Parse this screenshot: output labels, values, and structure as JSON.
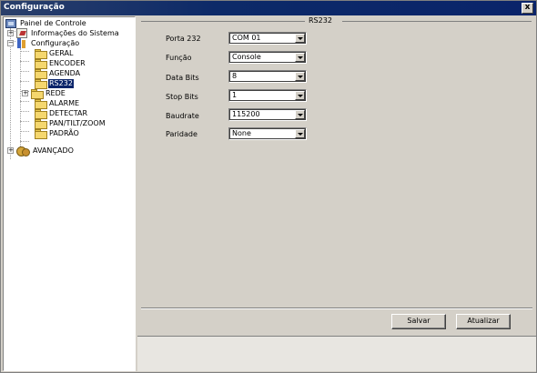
{
  "window": {
    "title": "Configuração",
    "close_label": "x"
  },
  "tree": {
    "root": "Painel de Controle",
    "items": [
      {
        "label": "Informações do Sistema"
      },
      {
        "label": "Configuração"
      },
      {
        "label": "GERAL"
      },
      {
        "label": "ENCODER"
      },
      {
        "label": "AGENDA"
      },
      {
        "label": "RS232"
      },
      {
        "label": "REDE"
      },
      {
        "label": "ALARME"
      },
      {
        "label": "DETECTAR"
      },
      {
        "label": "PAN/TILT/ZOOM"
      },
      {
        "label": "PADRÃO"
      },
      {
        "label": "AVANÇADO"
      }
    ]
  },
  "panel": {
    "group_title": "RS232",
    "fields": [
      {
        "label": "Porta 232",
        "value": "COM 01"
      },
      {
        "label": "Função",
        "value": "Console"
      },
      {
        "label": "Data Bits",
        "value": "8"
      },
      {
        "label": "Stop Bits",
        "value": "1"
      },
      {
        "label": "Baudrate",
        "value": "115200"
      },
      {
        "label": "Paridade",
        "value": "None"
      }
    ],
    "save_label": "Salvar",
    "refresh_label": "Atualizar"
  }
}
